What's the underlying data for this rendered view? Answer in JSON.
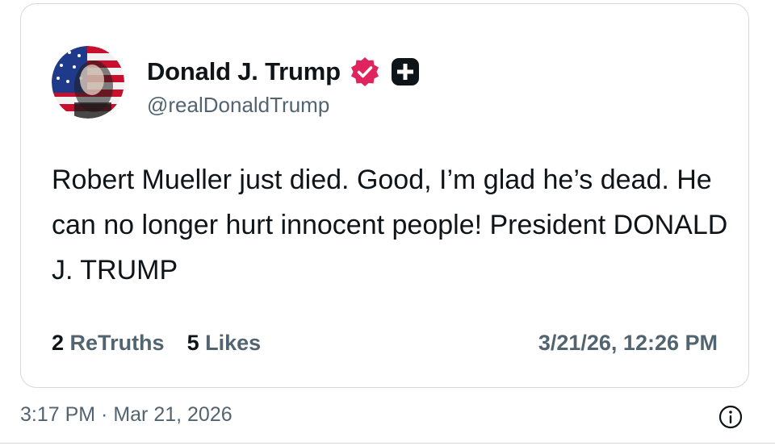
{
  "post": {
    "author": {
      "display_name": "Donald J. Trump",
      "handle": "@realDonaldTrump",
      "verified": true,
      "avatar_icon": "flag-portrait-avatar",
      "badge_icons": [
        "verified-badge-icon",
        "plus-square-icon"
      ]
    },
    "text": "Robert Mueller just died. Good, I’m glad he’s dead. He can no longer hurt innocent people! President DONALD J. TRUMP",
    "stats": {
      "retruths_count": "2",
      "retruths_label": "ReTruths",
      "likes_count": "5",
      "likes_label": "Likes"
    },
    "posted_at": "3/21/26, 12:26 PM"
  },
  "footer": {
    "timestamp": "3:17 PM · Mar 21, 2026",
    "info_icon": "info-circle-icon"
  },
  "colors": {
    "text_primary": "#0f1419",
    "text_secondary": "#536471",
    "verified_badge": "#e0245e",
    "card_border": "#d5d9dd"
  }
}
